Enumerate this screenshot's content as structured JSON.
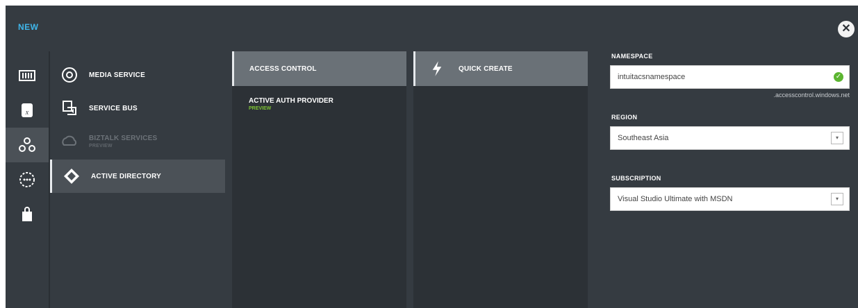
{
  "header": {
    "title": "NEW",
    "close_label": "✕"
  },
  "rail": {
    "items": [
      {
        "icon": "compute-icon",
        "selected": false
      },
      {
        "icon": "data-services-icon",
        "selected": false
      },
      {
        "icon": "app-services-icon",
        "selected": true
      },
      {
        "icon": "network-services-icon",
        "selected": false
      },
      {
        "icon": "store-icon",
        "selected": false
      }
    ]
  },
  "services": [
    {
      "label": "MEDIA SERVICE",
      "icon": "media-service-icon"
    },
    {
      "label": "SERVICE BUS",
      "icon": "service-bus-icon"
    },
    {
      "label": "BIZTALK SERVICES",
      "sub": "PREVIEW",
      "icon": "biztalk-icon",
      "disabled": true
    },
    {
      "label": "ACTIVE DIRECTORY",
      "icon": "active-directory-icon",
      "selected": true
    }
  ],
  "column2": {
    "header": "ACCESS CONTROL",
    "item": {
      "label": "ACTIVE AUTH PROVIDER",
      "sub": "PREVIEW"
    }
  },
  "column3": {
    "header": "QUICK CREATE",
    "icon": "lightning-icon"
  },
  "form": {
    "namespace_label": "NAMESPACE",
    "namespace_value": "intuitacsnamespace",
    "namespace_suffix": ".accesscontrol.windows.net",
    "region_label": "REGION",
    "region_value": "Southeast Asia",
    "subscription_label": "SUBSCRIPTION",
    "subscription_value": "Visual Studio Ultimate with MSDN",
    "dropdown_glyph": "▾",
    "valid_glyph": "✓"
  },
  "colors": {
    "accent": "#3fb6ea",
    "panel": "#353b41",
    "valid": "#5cb531",
    "preview": "#7dc234"
  }
}
